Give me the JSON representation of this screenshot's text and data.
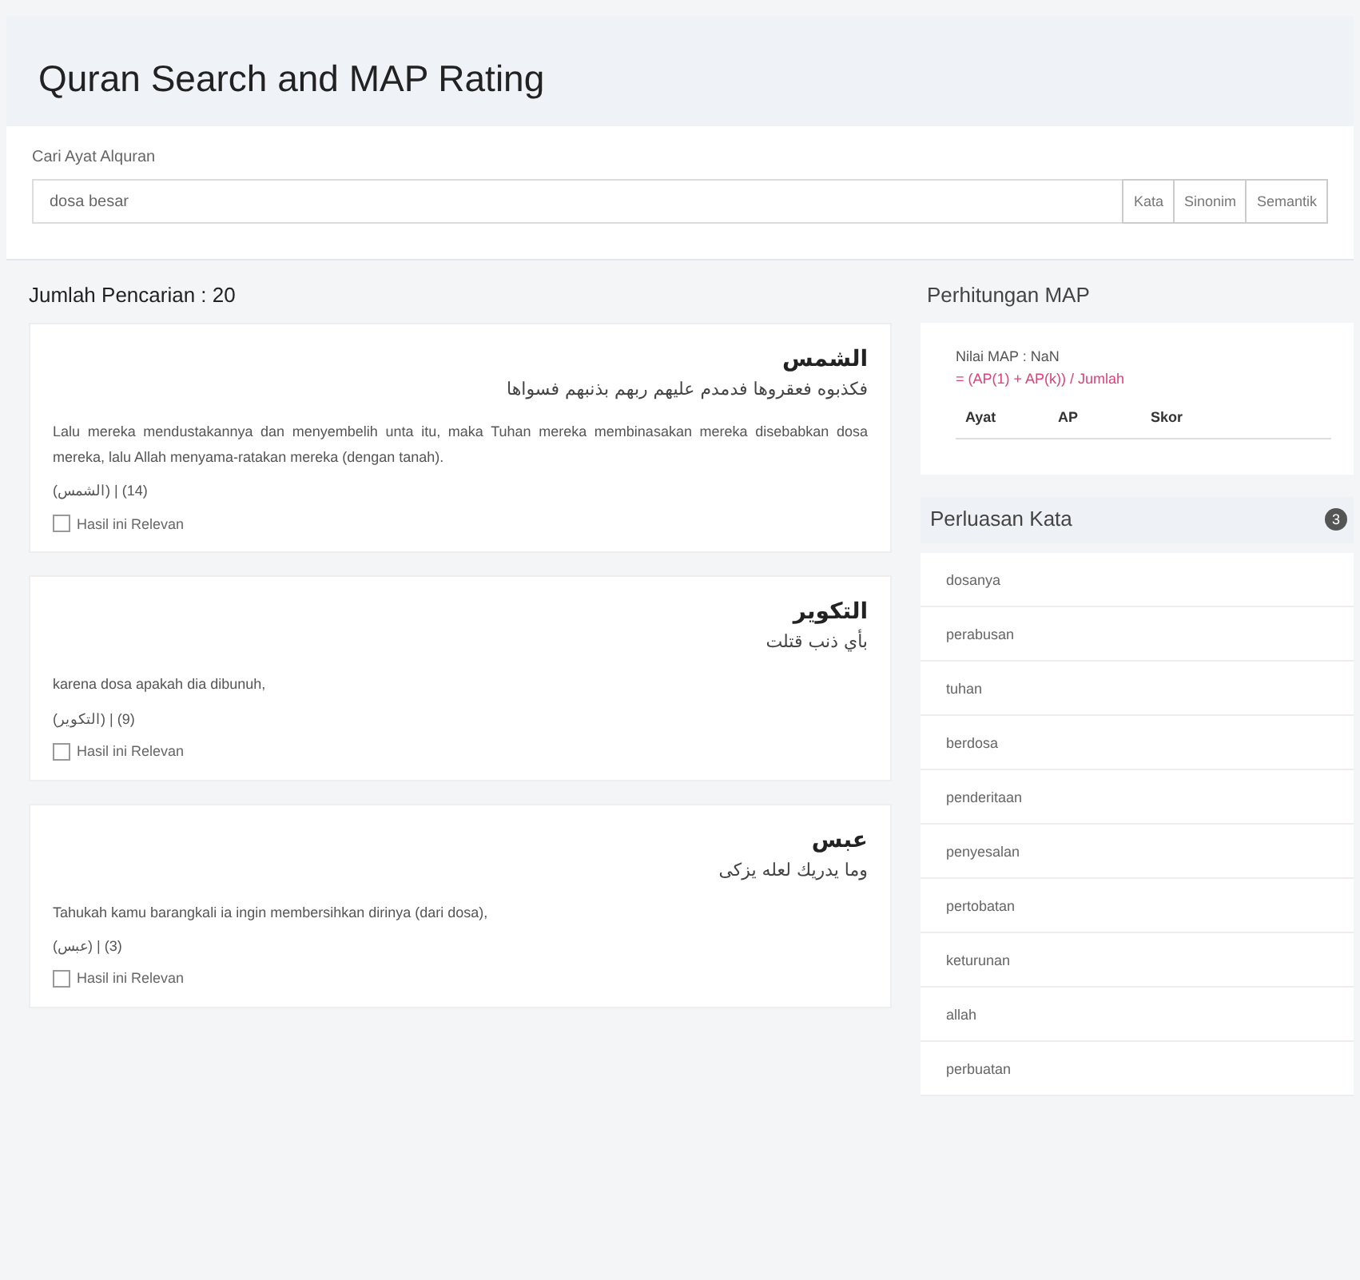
{
  "title": "Quran Search and MAP Rating",
  "search": {
    "label": "Cari Ayat Alquran",
    "value": "dosa besar",
    "buttons": [
      {
        "label": "Kata",
        "selected": false
      },
      {
        "label": "Sinonim",
        "selected": false
      },
      {
        "label": "Semantik",
        "selected": false
      }
    ]
  },
  "results_heading": "Jumlah Pencarian : 20",
  "results": [
    {
      "surah": "الشمس",
      "ayah": "فكذبوه فعقروها فدمدم عليهم ربهم بذنبهم فسواها",
      "translation": "Lalu mereka mendustakannya dan menyembelih unta itu, maka Tuhan mereka membinasakan mereka disebabkan dosa mereka, lalu Allah menyama-ratakan mereka (dengan tanah).",
      "reference": "(الشمس) | (14)",
      "relevance_label": "Hasil ini Relevan",
      "checked": false
    },
    {
      "surah": "التكوير",
      "ayah": "بأي ذنب قتلت",
      "translation": "karena dosa apakah dia dibunuh,",
      "reference": "(التكوير) | (9)",
      "relevance_label": "Hasil ini Relevan",
      "checked": false
    },
    {
      "surah": "عبس",
      "ayah": "وما يدريك لعله يزكى",
      "translation": "Tahukah kamu barangkali ia ingin membersihkan dirinya (dari dosa),",
      "reference": "(عبس) | (3)",
      "relevance_label": "Hasil ini Relevan",
      "checked": false
    }
  ],
  "map": {
    "heading": "Perhitungan MAP",
    "value": "Nilai MAP : NaN",
    "formula": "= (AP(1) + AP(k)) / Jumlah",
    "columns": [
      "Ayat",
      "AP",
      "Skor"
    ]
  },
  "expansion": {
    "heading": "Perluasan Kata",
    "badge": "3",
    "words": [
      "dosanya",
      "perabusan",
      "tuhan",
      "berdosa",
      "penderitaan",
      "penyesalan",
      "pertobatan",
      "keturunan",
      "allah",
      "perbuatan"
    ]
  }
}
